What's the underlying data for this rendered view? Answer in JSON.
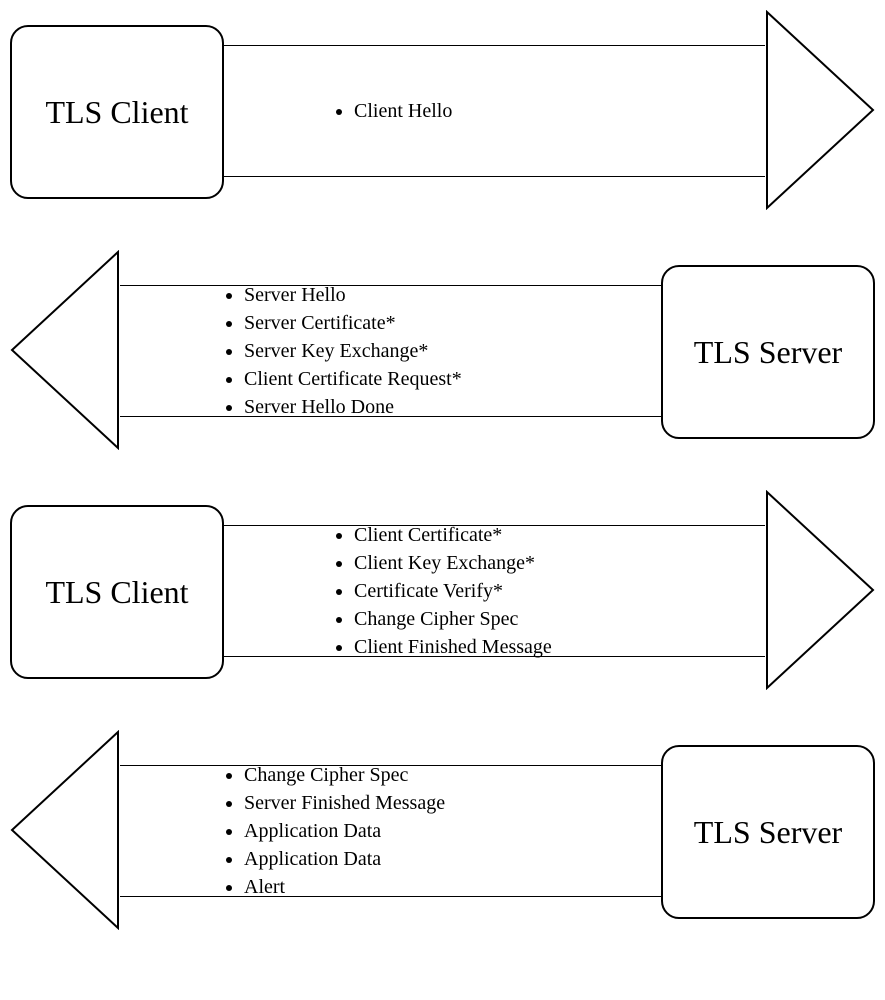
{
  "labels": {
    "client": "TLS Client",
    "server": "TLS Server"
  },
  "flows": [
    {
      "from": "client",
      "direction": "right",
      "messages": [
        "Client Hello"
      ]
    },
    {
      "from": "server",
      "direction": "left",
      "messages": [
        "Server Hello",
        "Server Certificate*",
        "Server Key Exchange*",
        "Client Certificate Request*",
        "Server Hello Done"
      ]
    },
    {
      "from": "client",
      "direction": "right",
      "messages": [
        "Client Certificate*",
        "Client Key Exchange*",
        "Certificate Verify*",
        "Change Cipher Spec",
        "Client Finished Message"
      ]
    },
    {
      "from": "server",
      "direction": "left",
      "messages": [
        "Change Cipher Spec",
        "Server Finished Message",
        "Application Data",
        "Application Data",
        "Alert"
      ]
    }
  ]
}
